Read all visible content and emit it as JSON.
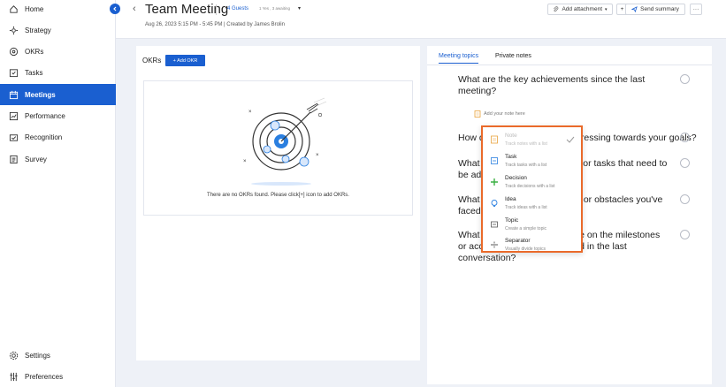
{
  "sidebar": {
    "items": [
      {
        "label": "Home",
        "icon": "home-icon"
      },
      {
        "label": "Strategy",
        "icon": "strategy-icon"
      },
      {
        "label": "OKRs",
        "icon": "target-icon"
      },
      {
        "label": "Tasks",
        "icon": "tasks-icon"
      },
      {
        "label": "Meetings",
        "icon": "calendar-icon",
        "active": true
      },
      {
        "label": "Performance",
        "icon": "performance-icon"
      },
      {
        "label": "Recognition",
        "icon": "recognition-icon"
      },
      {
        "label": "Survey",
        "icon": "survey-icon"
      }
    ],
    "bottom": [
      {
        "label": "Settings",
        "icon": "gear-icon"
      },
      {
        "label": "Preferences",
        "icon": "sliders-icon"
      }
    ]
  },
  "header": {
    "back": "‹",
    "title": "Team Meeting",
    "guests": "4 Guests",
    "guest_status": "1 Yes , 3 awaiting",
    "caret": "▾",
    "subtitle": "Aug 26, 2023 5:15 PM - 5:45 PM | Created by James Brolin",
    "add_attachment": "Add attachment",
    "plus": "+",
    "send_summary": "Send summary",
    "more": "···"
  },
  "okr": {
    "label": "OKRs",
    "add_button": "+ Add OKR",
    "empty_text": "There are no OKRs found. Please click[+] icon to add OKRs."
  },
  "right": {
    "tabs": [
      "Meeting topics",
      "Private notes"
    ],
    "note_hint": "Add your note here",
    "topics": [
      "What are the key achievements since the last meeting?",
      "How do you think we are progressing towards your goals?",
      "What are the key action items or tasks that need to be addressed?",
      "What are the main challenges or obstacles you've faced since our last meeting?",
      "What progress have you made on the milestones or accomplishments discussed in the last conversation?"
    ]
  },
  "dropdown": {
    "items": [
      {
        "title": "Note",
        "sub": "Track notes with a list",
        "icon": "note-icon",
        "disabled": true
      },
      {
        "title": "Task",
        "sub": "Track tasks with a list",
        "icon": "task-icon"
      },
      {
        "title": "Decision",
        "sub": "Track decisions with a list",
        "icon": "decision-icon"
      },
      {
        "title": "Idea",
        "sub": "Track ideas with a list",
        "icon": "idea-icon"
      },
      {
        "title": "Topic",
        "sub": "Create a simple topic",
        "icon": "topic-icon"
      },
      {
        "title": "Separator",
        "sub": "Visually divide topics",
        "icon": "separator-icon"
      }
    ]
  },
  "colors": {
    "accent": "#1a5fd0",
    "highlight": "#ea6a2a"
  }
}
